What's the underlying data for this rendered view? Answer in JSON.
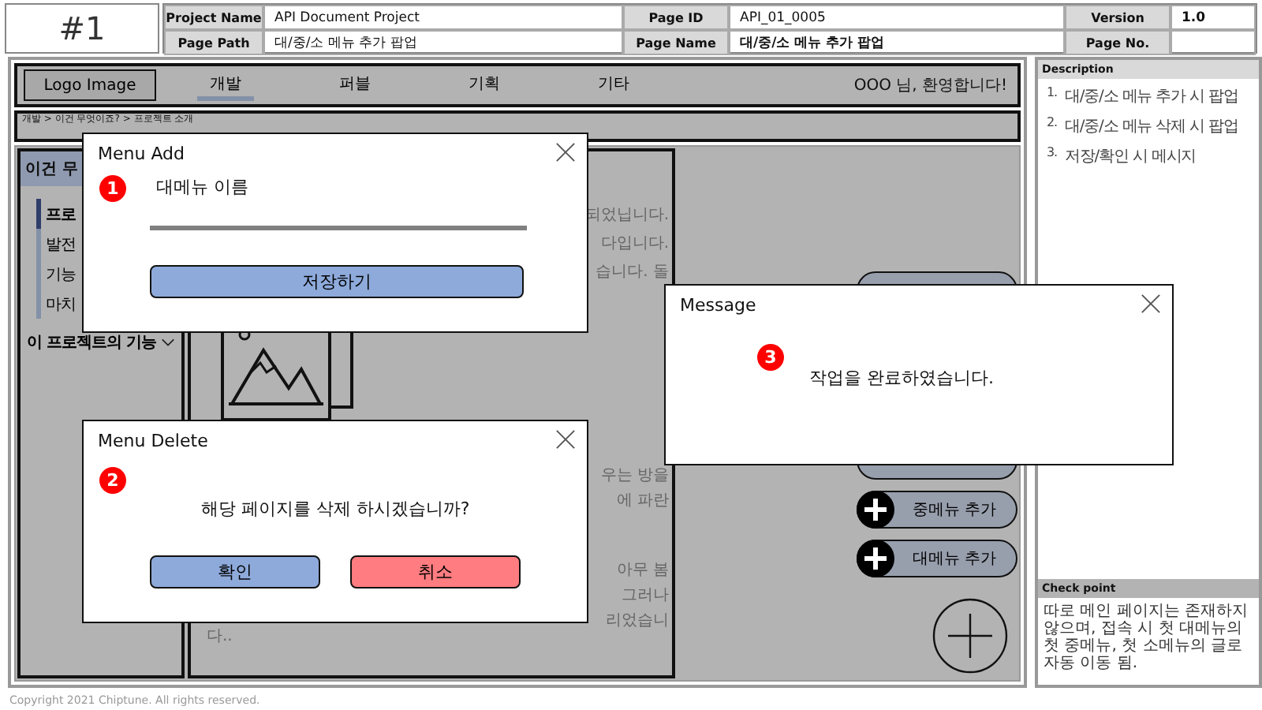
{
  "header": {
    "number": "#1",
    "fields": [
      {
        "label": "Project Name",
        "value": "API Document Project",
        "bold": false
      },
      {
        "label": "Page ID",
        "value": "API_01_0005",
        "bold": false
      },
      {
        "label": "Version",
        "value": "1.0",
        "bold": true
      },
      {
        "label": "Page Path",
        "value": "대/중/소 메뉴 추가 팝업",
        "bold": false
      },
      {
        "label": "Page Name",
        "value": "대/중/소 메뉴 추가 팝업",
        "bold": true
      },
      {
        "label": "Page No."
      }
    ]
  },
  "nav": {
    "logo": "Logo Image",
    "tabs": [
      {
        "label": "개발",
        "selected": true
      },
      {
        "label": "퍼블",
        "selected": false
      },
      {
        "label": "기획",
        "selected": false
      },
      {
        "label": "기타",
        "selected": false
      }
    ],
    "greeting": "OOO 님, 환영합니다!"
  },
  "breadcrumb": "개발 > 이건 무엇이죠? > 프로젝트 소개",
  "sidebar": {
    "title": "이건 무",
    "items": [
      {
        "label": "프로",
        "selected": true
      },
      {
        "label": "발전",
        "selected": false
      },
      {
        "label": "기능",
        "selected": false
      },
      {
        "label": "마치",
        "selected": false
      }
    ],
    "section": "이 프로젝트의 기능"
  },
  "content": {
    "upper_lines": [
      "되었닙니다.",
      "다입니다.",
      "습니다. 돌"
    ],
    "lower_lines": [
      "우는 방을",
      "에 파란",
      "아무 봄",
      "그러나",
      "리었습니"
    ],
    "tail": "다.."
  },
  "menu_buttons": [
    {
      "label": "중메뉴 추가"
    },
    {
      "label": "대메뉴 추가"
    }
  ],
  "dialogs": [
    {
      "kind": "input",
      "title": "Menu Add",
      "badge": "1",
      "label": "대메뉴 이름",
      "buttons": [
        {
          "label": "저장하기",
          "color": "#8eaadb"
        }
      ]
    },
    {
      "kind": "confirm",
      "title": "Menu Delete",
      "badge": "2",
      "message": "해당 페이지를 삭제 하시겠습니까?",
      "buttons": [
        {
          "label": "확인",
          "color": "#8eaadb"
        },
        {
          "label": "취소",
          "color": "#ff7c80"
        }
      ]
    },
    {
      "kind": "message",
      "title": "Message",
      "badge": "3",
      "message": "작업을 완료하였습니다."
    }
  ],
  "description": {
    "title": "Description",
    "items": [
      {
        "number": "1.",
        "text": "대/중/소 메뉴 추가 시 팝업"
      },
      {
        "number": "2.",
        "text": "대/중/소 메뉴 삭제 시 팝업"
      },
      {
        "number": "3.",
        "text": "저장/확인 시 메시지"
      }
    ]
  },
  "check_point": {
    "title": "Check point",
    "text": "따로 메인 페이지는 존재하지 않으며, 접속 시 첫 대메뉴의 첫 중메뉴, 첫 소메뉴의 글로 자동 이동 됨."
  },
  "footer": "Copyright 2021 Chiptune.  All rights reserved."
}
